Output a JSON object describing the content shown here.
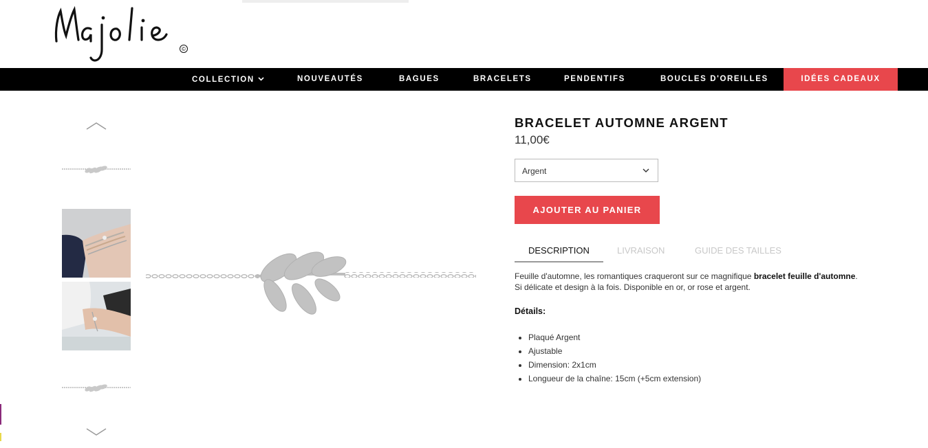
{
  "brand": {
    "name": "Majolie",
    "copyright_mark": "©"
  },
  "nav": {
    "items": [
      {
        "label": "COLLECTION"
      },
      {
        "label": "NOUVEAUTÉS"
      },
      {
        "label": "BAGUES"
      },
      {
        "label": "BRACELETS"
      },
      {
        "label": "PENDENTIFS"
      },
      {
        "label": "BOUCLES D'OREILLES"
      },
      {
        "label": "IDÉES CADEAUX"
      }
    ]
  },
  "product": {
    "title": "BRACELET AUTOMNE ARGENT",
    "price": "11,00€",
    "variant_selected": "Argent",
    "add_to_cart": "AJOUTER AU PANIER"
  },
  "tabs": [
    {
      "label": "DESCRIPTION",
      "active": true
    },
    {
      "label": "LIVRAISON",
      "active": false
    },
    {
      "label": "GUIDE DES TAILLES",
      "active": false
    }
  ],
  "description": {
    "intro": "Feuille d'automne, les romantiques craqueront sur ce magnifique ",
    "bold": "bracelet feuille d'automne",
    "rest": ". Si délicate et design à la fois. Disponible en or, or rose et argent.",
    "details_heading": "Détails:",
    "details": [
      "Plaqué Argent",
      "Ajustable",
      "Dimension: 2x1cm",
      "Longueur de la chaîne: 15cm (+5cm extension)"
    ]
  },
  "colors": {
    "accent": "#e8474c",
    "nav_bg": "#000000",
    "silver": "#b5b5b5"
  },
  "icons": {
    "thumb_up": "chevron-up-icon",
    "thumb_down": "chevron-down-icon",
    "select_caret": "chevron-down-icon"
  }
}
